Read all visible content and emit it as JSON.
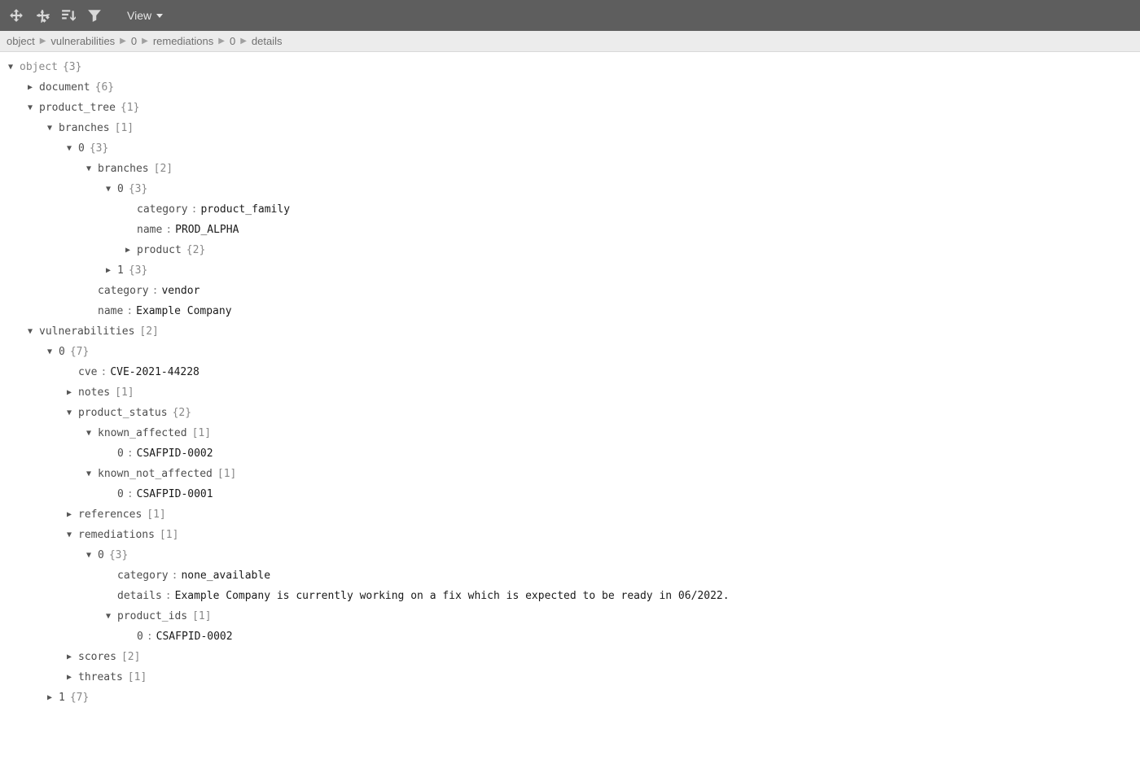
{
  "toolbar": {
    "view_label": "View"
  },
  "breadcrumb": [
    "object",
    "vulnerabilities",
    "0",
    "remediations",
    "0",
    "details"
  ],
  "tree": {
    "root_key": "object",
    "root_meta": "{3}",
    "document_key": "document",
    "document_meta": "{6}",
    "ptree_key": "product_tree",
    "ptree_meta": "{1}",
    "branches_key": "branches",
    "branches_meta": "[1]",
    "b0_key": "0",
    "b0_meta": "{3}",
    "b0_branches_key": "branches",
    "b0_branches_meta": "[2]",
    "bb0_key": "0",
    "bb0_meta": "{3}",
    "bb0_cat_key": "category",
    "bb0_cat_val": "product_family",
    "bb0_name_key": "name",
    "bb0_name_val": "PROD_ALPHA",
    "bb0_prod_key": "product",
    "bb0_prod_meta": "{2}",
    "bb1_key": "1",
    "bb1_meta": "{3}",
    "b0_cat_key": "category",
    "b0_cat_val": "vendor",
    "b0_name_key": "name",
    "b0_name_val": "Example Company",
    "vulns_key": "vulnerabilities",
    "vulns_meta": "[2]",
    "v0_key": "0",
    "v0_meta": "{7}",
    "v0_cve_key": "cve",
    "v0_cve_val": "CVE-2021-44228",
    "v0_notes_key": "notes",
    "v0_notes_meta": "[1]",
    "v0_ps_key": "product_status",
    "v0_ps_meta": "{2}",
    "v0_ka_key": "known_affected",
    "v0_ka_meta": "[1]",
    "v0_ka0_key": "0",
    "v0_ka0_val": "CSAFPID-0002",
    "v0_kna_key": "known_not_affected",
    "v0_kna_meta": "[1]",
    "v0_kna0_key": "0",
    "v0_kna0_val": "CSAFPID-0001",
    "v0_refs_key": "references",
    "v0_refs_meta": "[1]",
    "v0_rem_key": "remediations",
    "v0_rem_meta": "[1]",
    "v0_r0_key": "0",
    "v0_r0_meta": "{3}",
    "v0_r0_cat_key": "category",
    "v0_r0_cat_val": "none_available",
    "v0_r0_det_key": "details",
    "v0_r0_det_val": "Example Company is currently working on a fix which is expected to be ready in 06/2022.",
    "v0_r0_pids_key": "product_ids",
    "v0_r0_pids_meta": "[1]",
    "v0_r0_pid0_key": "0",
    "v0_r0_pid0_val": "CSAFPID-0002",
    "v0_scores_key": "scores",
    "v0_scores_meta": "[2]",
    "v0_threats_key": "threats",
    "v0_threats_meta": "[1]",
    "v1_key": "1",
    "v1_meta": "{7}"
  }
}
